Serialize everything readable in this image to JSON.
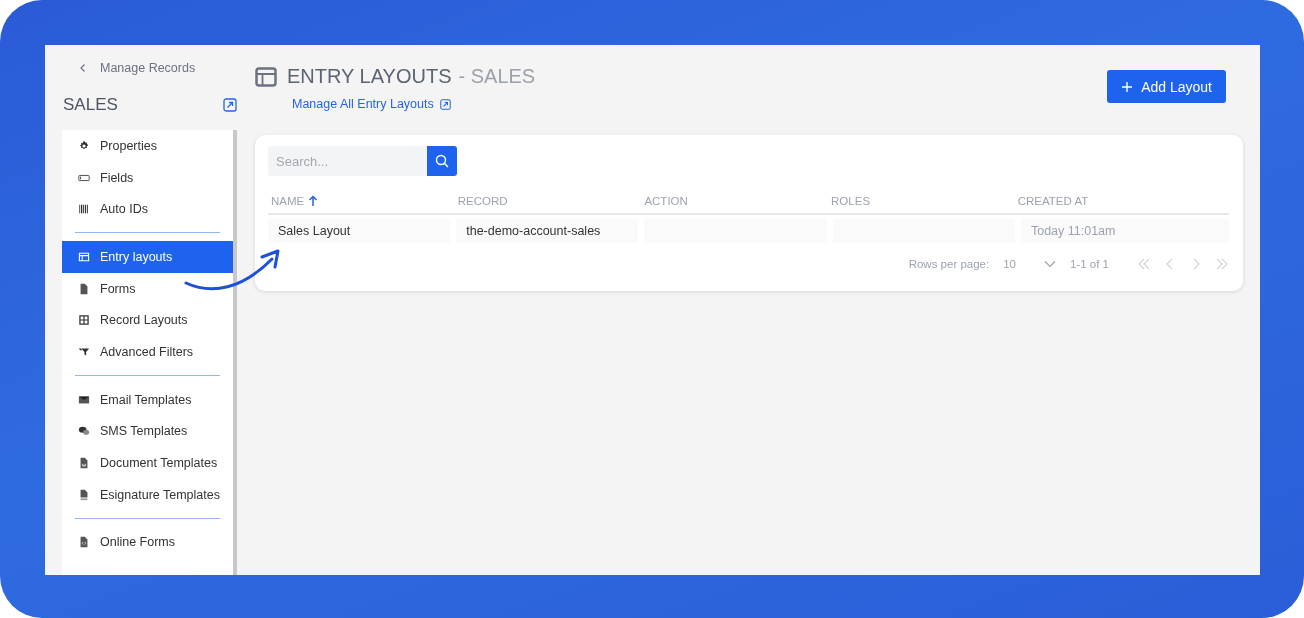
{
  "back_link": {
    "label": "Manage Records"
  },
  "sidebar": {
    "title": "SALES",
    "groups": [
      [
        {
          "label": "Properties",
          "selected": false
        },
        {
          "label": "Fields",
          "selected": false
        },
        {
          "label": "Auto IDs",
          "selected": false
        }
      ],
      [
        {
          "label": "Entry layouts",
          "selected": true
        },
        {
          "label": "Forms",
          "selected": false
        },
        {
          "label": "Record Layouts",
          "selected": false
        },
        {
          "label": "Advanced Filters",
          "selected": false
        }
      ],
      [
        {
          "label": "Email Templates",
          "selected": false
        },
        {
          "label": "SMS Templates",
          "selected": false
        },
        {
          "label": "Document Templates",
          "selected": false
        },
        {
          "label": "Esignature Templates",
          "selected": false
        }
      ],
      [
        {
          "label": "Online Forms",
          "selected": false
        }
      ]
    ]
  },
  "header": {
    "title": "ENTRY LAYOUTS",
    "subtitle": "- SALES",
    "link": "Manage All Entry Layouts",
    "button": "Add Layout"
  },
  "search": {
    "placeholder": "Search..."
  },
  "table": {
    "columns": [
      {
        "label": "NAME",
        "sorted": true
      },
      {
        "label": "RECORD",
        "sorted": false
      },
      {
        "label": "ACTION",
        "sorted": false
      },
      {
        "label": "ROLES",
        "sorted": false
      },
      {
        "label": "CREATED AT",
        "sorted": false
      }
    ],
    "rows": [
      {
        "cells": [
          "Sales Layout",
          "the-demo-account-sales",
          "",
          "",
          "Today  11:01am"
        ]
      }
    ]
  },
  "pagination": {
    "rows_per_page_label": "Rows per page:",
    "rows_per_page": "10",
    "range": "1-1 of 1"
  }
}
